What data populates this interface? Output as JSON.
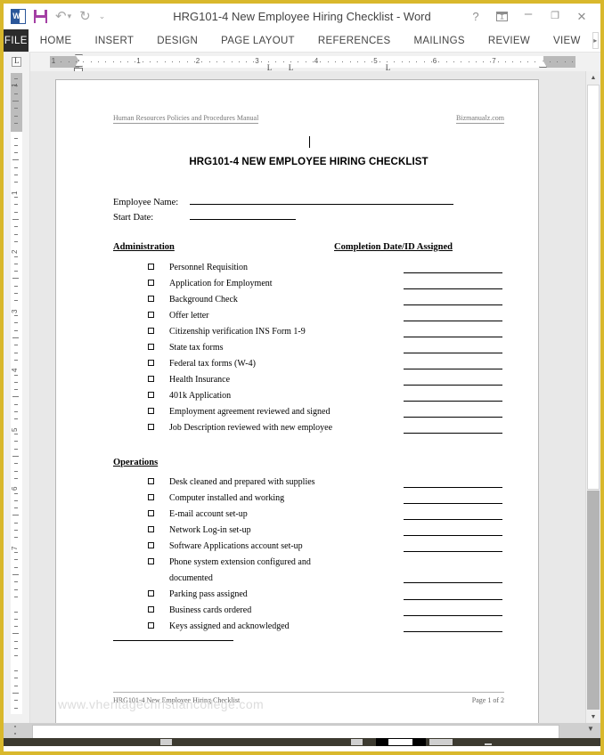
{
  "window": {
    "title": "HRG101-4 New Employee Hiring Checklist - Word",
    "quick_access": [
      {
        "name": "word-app-icon",
        "label": "W"
      },
      {
        "name": "save-icon",
        "label": ""
      },
      {
        "name": "undo-icon",
        "label": "↶"
      },
      {
        "name": "undo-dropdown-icon",
        "label": "▾"
      },
      {
        "name": "redo-icon",
        "label": "↻"
      },
      {
        "name": "customize-quick-access-icon",
        "label": "⌄"
      }
    ],
    "controls": [
      {
        "name": "help-button",
        "label": "?"
      },
      {
        "name": "ribbon-display-options-button",
        "label": ""
      },
      {
        "name": "minimize-button",
        "label": "–"
      },
      {
        "name": "restore-button",
        "label": "❐"
      },
      {
        "name": "close-button",
        "label": "✕"
      }
    ]
  },
  "ribbon": {
    "file_tab": "FILE",
    "tabs": [
      "HOME",
      "INSERT",
      "DESIGN",
      "PAGE LAYOUT",
      "REFERENCES",
      "MAILINGS",
      "REVIEW",
      "VIEW"
    ],
    "overflow_arrow": "▸"
  },
  "rulers": {
    "horizontal_numbers": [
      "1",
      "1",
      "2",
      "3",
      "4",
      "5",
      "6",
      "7"
    ],
    "vertical_numbers": [
      "1",
      "1",
      "2",
      "3",
      "4",
      "5",
      "6",
      "7"
    ],
    "tab_stop_selector": "L"
  },
  "document": {
    "header_left": "Human Resources Policies and Procedures Manual",
    "header_right": "Bizmanualz.com",
    "title": "HRG101-4 NEW EMPLOYEE HIRING CHECKLIST",
    "fields": [
      {
        "label": "Employee Name:",
        "value": "",
        "line_width": 296
      },
      {
        "label": "Start Date:",
        "value": "",
        "line_width": 119
      }
    ],
    "right_column_heading": "Completion Date/ID Assigned",
    "sections": [
      {
        "heading": "Administration",
        "items": [
          {
            "label": "Personnel Requisition",
            "checked": false,
            "date_value": ""
          },
          {
            "label": "Application for Employment",
            "checked": false,
            "date_value": ""
          },
          {
            "label": "Background Check",
            "checked": false,
            "date_value": ""
          },
          {
            "label": "Offer letter",
            "checked": false,
            "date_value": ""
          },
          {
            "label": "Citizenship verification INS Form 1-9",
            "checked": false,
            "date_value": ""
          },
          {
            "label": "State tax forms",
            "checked": false,
            "date_value": ""
          },
          {
            "label": "Federal tax forms (W-4)",
            "checked": false,
            "date_value": ""
          },
          {
            "label": "Health Insurance",
            "checked": false,
            "date_value": ""
          },
          {
            "label": "401k Application",
            "checked": false,
            "date_value": ""
          },
          {
            "label": "Employment agreement reviewed and signed",
            "checked": false,
            "date_value": ""
          },
          {
            "label": "Job Description reviewed with new employee",
            "checked": false,
            "date_value": ""
          }
        ]
      },
      {
        "heading": "Operations",
        "items": [
          {
            "label": "Desk cleaned and prepared with supplies",
            "checked": false,
            "date_value": ""
          },
          {
            "label": "Computer installed and working",
            "checked": false,
            "date_value": ""
          },
          {
            "label": "E-mail account set-up",
            "checked": false,
            "date_value": ""
          },
          {
            "label": "Network Log-in set-up",
            "checked": false,
            "date_value": ""
          },
          {
            "label": "Software Applications account set-up",
            "checked": false,
            "date_value": ""
          },
          {
            "label": "Phone system extension configured and\ndocumented",
            "checked": false,
            "date_value": ""
          },
          {
            "label": "Parking pass assigned",
            "checked": false,
            "date_value": ""
          },
          {
            "label": "Business cards ordered",
            "checked": false,
            "date_value": ""
          },
          {
            "label": "Keys assigned and acknowledged",
            "checked": false,
            "date_value": ""
          }
        ]
      }
    ],
    "footer_left": "HRG101-4 New Employee Hiring Checklist",
    "footer_right": "Page 1 of 2",
    "watermark": "www.vheritagechristiancollege.com"
  },
  "scrollbar": {
    "up_arrow": "▲",
    "down_arrow": "▼"
  },
  "colors": {
    "window_border": "#d9b82c",
    "file_tab_bg": "#2b2b2b",
    "word_blue": "#2b579a",
    "save_purple": "#a43fa4",
    "page_bg": "#ffffff",
    "canvas_bg": "#e8e8e8"
  }
}
